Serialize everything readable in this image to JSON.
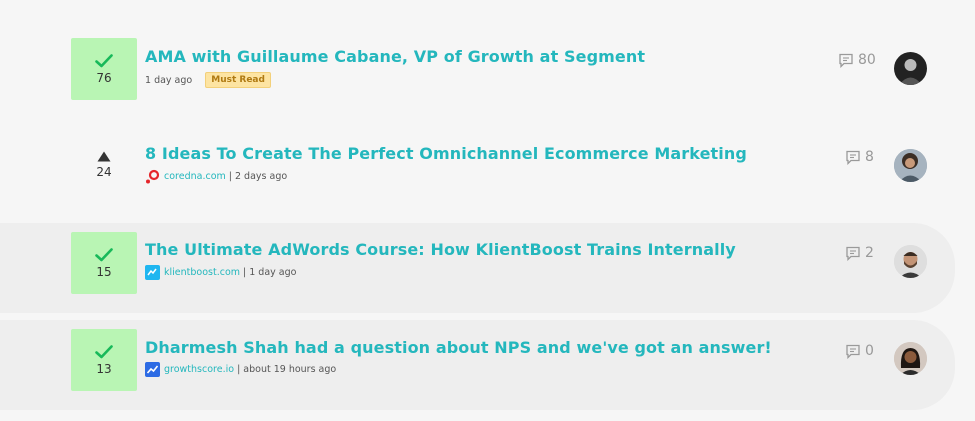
{
  "posts": [
    {
      "votes": "76",
      "voted": true,
      "title": "AMA with Guillaume Cabane, VP of Growth at Segment",
      "time": "1 day ago",
      "badge": "Must Read",
      "comments": "80",
      "avatar_icon": "avatar-dark"
    },
    {
      "votes": "24",
      "voted": false,
      "title": "8 Ideas To Create The Perfect Omnichannel Ecommerce Marketing",
      "source": "coredna.com",
      "time": "| 2 days ago",
      "source_icon": "coredna-logo-icon",
      "comments": "8",
      "avatar_icon": "avatar-curly"
    },
    {
      "votes": "15",
      "voted": true,
      "title": "The Ultimate AdWords Course: How KlientBoost Trains Internally",
      "source": "klientboost.com",
      "time": "| 1 day ago",
      "source_icon": "klientboost-logo-icon",
      "comments": "2",
      "avatar_icon": "avatar-beard"
    },
    {
      "votes": "13",
      "voted": true,
      "title": "Dharmesh Shah had a question about NPS and we've got an answer!",
      "source": "growthscore.io",
      "time": "| about 19 hours ago",
      "source_icon": "growthscore-logo-icon",
      "comments": "0",
      "avatar_icon": "avatar-woman"
    }
  ],
  "colors": {
    "accent": "#24b7bd",
    "voted_bg": "#b9f5b4",
    "check": "#18b95a",
    "badge_bg": "#fde4a2"
  }
}
